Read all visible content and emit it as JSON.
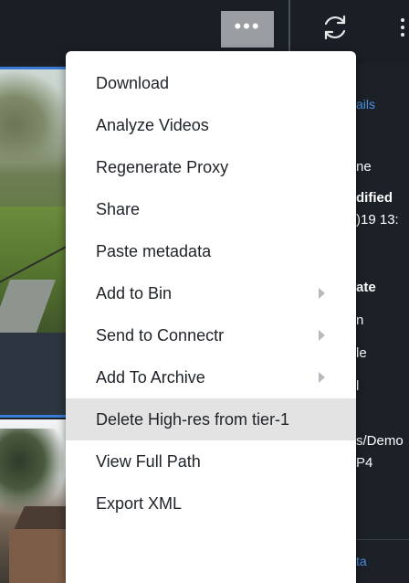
{
  "toolbar": {
    "more_label": "•••",
    "icons": {
      "more": "more-horizontal-icon",
      "refresh": "refresh-icon",
      "overflow": "kebab-vertical-icon"
    }
  },
  "details_panel": {
    "lines": [
      "ails",
      "ne",
      "dified",
      ")19 13:",
      "ate",
      "n",
      "le",
      "l",
      "s/Demo",
      "P4",
      "ta"
    ]
  },
  "menu": {
    "items": [
      {
        "label": "Download",
        "has_submenu": false
      },
      {
        "label": "Analyze Videos",
        "has_submenu": false
      },
      {
        "label": "Regenerate Proxy",
        "has_submenu": false
      },
      {
        "label": "Share",
        "has_submenu": false
      },
      {
        "label": "Paste metadata",
        "has_submenu": false
      },
      {
        "label": "Add to Bin",
        "has_submenu": true
      },
      {
        "label": "Send to Connectr",
        "has_submenu": true
      },
      {
        "label": "Add To Archive",
        "has_submenu": true
      },
      {
        "label": "Delete High-res from tier-1",
        "has_submenu": false,
        "highlighted": true
      },
      {
        "label": "View Full Path",
        "has_submenu": false
      },
      {
        "label": "Export XML",
        "has_submenu": false
      }
    ]
  },
  "colors": {
    "accent": "#3a7bd5",
    "link": "#4a90e2",
    "background": "#1c2128",
    "menu_background": "#ffffff",
    "menu_highlight": "#e3e3e3"
  }
}
